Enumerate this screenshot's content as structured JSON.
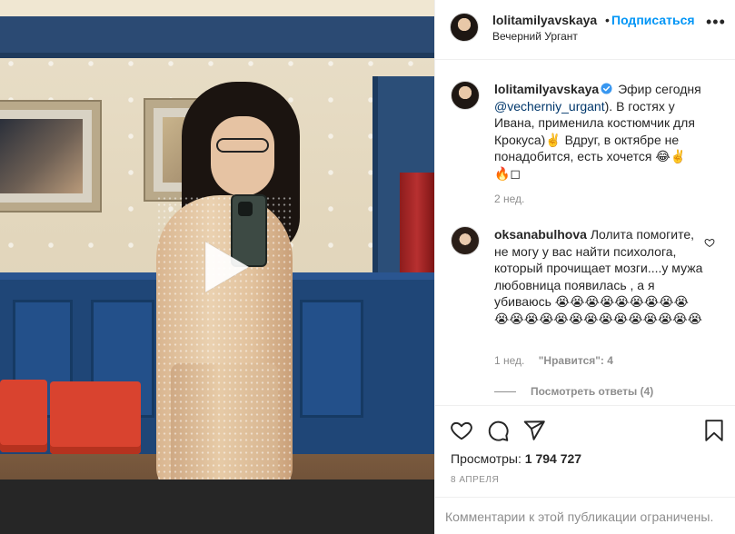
{
  "media": {
    "type": "video",
    "play_icon": "play-icon"
  },
  "header": {
    "username": "lolitamilyavskaya",
    "separator": "•",
    "follow_label": "Подписаться",
    "location": "Вечерний Ургант",
    "more_icon": "more-icon",
    "more_label": "•••"
  },
  "caption": {
    "username": "lolitamilyavskaya",
    "verified_icon": "verified-badge-icon",
    "text_before_mention": "Эфир сегодня",
    "mention": "@vecherniy_urgant",
    "text_after_mention": "). В гостях у Ивана, применила костюмчик для Крокуса)✌️ Вдруг, в октябре не понадобится, есть хочется 😂✌️ 🔥◻",
    "time": "2 нед."
  },
  "comment": {
    "username": "oksanabulhova",
    "text": "Лолита помогите, не могу у вас найти психолога, который прочищает мозги....у мужа любовница появилась , а я убиваюсь 😭😭😭😭😭😭😭😭😭😭😭😭😭😭😭😭😭😭😭😭😭😭😭",
    "time": "1 нед.",
    "likes": "\"Нравится\": 4",
    "heart_icon": "heart-outline-icon",
    "view_replies": "Посмотреть ответы (4)"
  },
  "actions": {
    "like_icon": "heart-icon",
    "comment_icon": "comment-icon",
    "share_icon": "share-icon",
    "save_icon": "bookmark-icon"
  },
  "stats": {
    "views_label": "Просмотры:",
    "views_value": "1 794 727",
    "date": "8 АПРЕЛЯ"
  },
  "footer": {
    "restricted_text": "Комментарии к этой публикации ограничены."
  },
  "colors": {
    "accent": "#0095f6",
    "mention": "#00376b",
    "muted": "#8e8e8e",
    "verified": "#3897f0"
  }
}
